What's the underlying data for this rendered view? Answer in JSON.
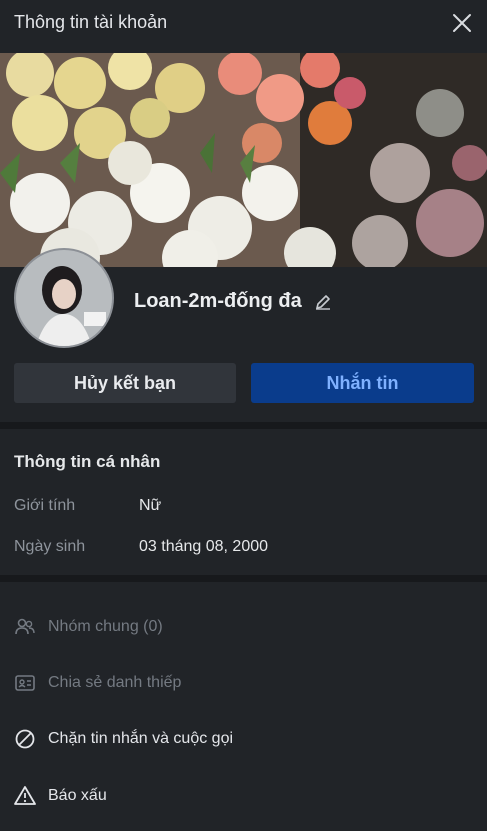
{
  "header": {
    "title": "Thông tin tài khoản"
  },
  "profile": {
    "name": "Loan-2m-đống đa"
  },
  "buttons": {
    "unfriend": "Hủy kết bạn",
    "message": "Nhắn tin"
  },
  "personal_info": {
    "title": "Thông tin cá nhân",
    "gender_label": "Giới tính",
    "gender_value": "Nữ",
    "birthday_label": "Ngày sinh",
    "birthday_value": "03 tháng 08, 2000"
  },
  "actions": {
    "common_groups": "Nhóm chung (0)",
    "share_card": "Chia sẻ danh thiếp",
    "block": "Chặn tin nhắn và cuộc gọi",
    "report": "Báo xấu"
  },
  "colors": {
    "primary_button": "#0a3c8c",
    "primary_text": "#7fb1ff",
    "background": "#212428"
  },
  "icons": [
    "close-icon",
    "edit-icon",
    "group-icon",
    "contact-card-icon",
    "block-icon",
    "warning-icon"
  ]
}
